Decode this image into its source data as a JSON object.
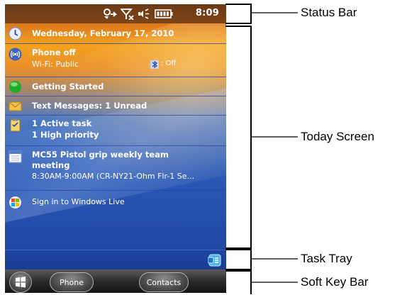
{
  "status_bar": {
    "time": "8:09"
  },
  "today": {
    "date": "Wednesday, February 17, 2010",
    "phone": {
      "title": "Phone off",
      "wifi": "Wi-Fi: Public",
      "bluetooth": ": Off"
    },
    "getting_started": "Getting Started",
    "messages": "Text Messages: 1 Unread",
    "tasks": {
      "line1": "1 Active task",
      "line2": "1 High priority"
    },
    "calendar": {
      "title_line1": "MC55 Pistol grip weekly team",
      "title_line2": "meeting",
      "detail": "8:30AM-9:00AM (CR-NY21-Ohm Flr-1 Se..."
    },
    "windows_live": "Sign in to Windows Live"
  },
  "soft_keys": {
    "left": "Phone",
    "right": "Contacts"
  },
  "callouts": {
    "status_bar": "Status Bar",
    "today_screen": "Today Screen",
    "task_tray": "Task Tray",
    "soft_key_bar": "Soft Key Bar"
  },
  "colors": {
    "callout_line": "#000000",
    "row_separator": "#2846aa",
    "status_bar_bg": "#7c4419"
  },
  "icons": [
    "sync-icon",
    "no-signal-icon",
    "speaker-icon",
    "battery-icon",
    "clock-icon",
    "antenna-icon",
    "green-orb-icon",
    "envelope-icon",
    "clipboard-icon",
    "calendar-icon",
    "windows-live-icon",
    "task-manager-icon",
    "windows-start-icon"
  ]
}
